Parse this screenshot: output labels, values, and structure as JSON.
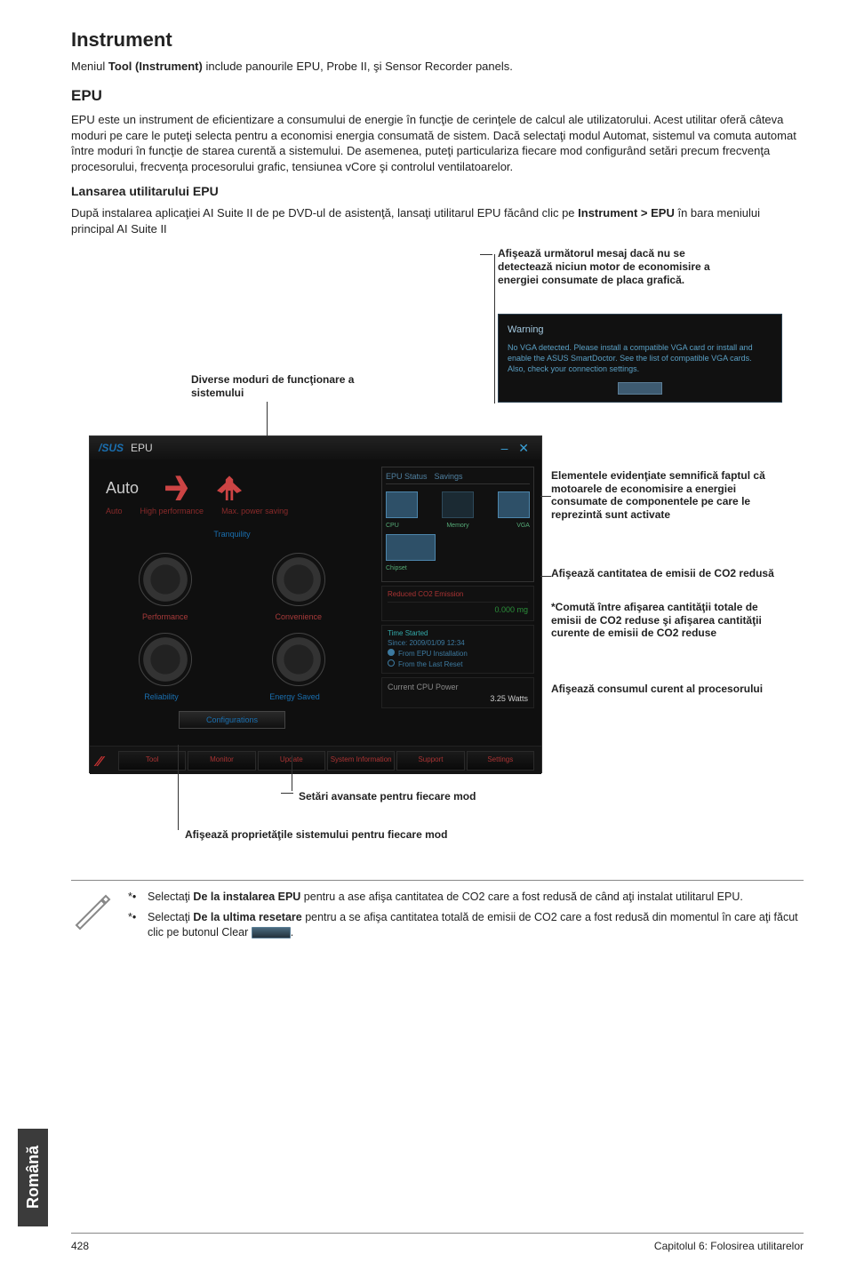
{
  "heading": "Instrument",
  "intro": {
    "pre": "Meniul ",
    "bold": "Tool (Instrument)",
    "post": " include panourile EPU, Probe II, şi  Sensor Recorder panels."
  },
  "epu_heading": "EPU",
  "epu_para": "EPU este un instrument de eficientizare a consumului de energie în funcţie de cerinţele de calcul ale utilizatorului. Acest utilitar oferă câteva moduri pe care le puteţi selecta pentru a economisi energia consumată de sistem. Dacă selectaţi modul Automat, sistemul va comuta automat între moduri în funcţie de starea curentă a sistemului. De asemenea, puteţi particulariza fiecare mod configurând setări precum frecvenţa procesorului, frecvenţa procesorului grafic, tensiunea vCore şi controlul ventilatoarelor.",
  "launch_heading": "Lansarea utilitarului EPU",
  "launch_para": {
    "p1": "După instalarea aplicaţiei AI Suite II de pe DVD-ul de asistenţă, lansaţi utilitarul EPU făcând clic pe ",
    "bold": "Instrument > EPU",
    "p2": " în bara meniului principal AI Suite II"
  },
  "callouts": {
    "warning": "Afişează următorul mesaj dacă nu se detectează niciun motor de economisire a energiei consumate de placa grafică.",
    "modes": "Diverse moduri de funcţionare a sistemului",
    "elements": "Elementele evidenţiate semnifică faptul că motoarele de economisire a energiei consumate de componentele pe care le reprezintă sunt activate",
    "co2": "Afişează cantitatea de emisii de CO2 redusă",
    "toggle": "*Comută între afişarea cantităţii totale de emisii de CO2 reduse şi afişarea cantităţii curente de emisii de CO2 reduse",
    "power": "Afişează consumul curent al procesorului",
    "settings": "Setări avansate pentru fiecare mod",
    "props": "Afişează proprietăţile sistemului pentru fiecare mod"
  },
  "app": {
    "brand": "/SUS",
    "title": "EPU",
    "auto": "Auto",
    "auto_sub1": "Auto",
    "auto_sub2": "High performance",
    "auto_sub3": "Max. power saving",
    "tranquility": "Tranquility",
    "performance": "Performance",
    "convenience": "Convenience",
    "reliability": "Reliability",
    "energy": "Energy Saved",
    "config": "Configurations",
    "status_head1": "EPU Status",
    "status_head2": "Savings",
    "thumb_cpu": "CPU",
    "thumb_mem": "Memory",
    "thumb_vga": "VGA",
    "chipset": "Chipset",
    "co2_head": "Reduced CO2 Emission",
    "co2_val": "0.000 mg",
    "since_head": "Time Started",
    "since_date": "Since: 2009/01/09 12:34",
    "radio_on": "From EPU Installation",
    "radio_off": "From the Last Reset",
    "power_head": "Current CPU Power",
    "power_val": "3.25 Watts",
    "footer": [
      "Tool",
      "Monitor",
      "Update",
      "System Information",
      "Support",
      "Settings"
    ]
  },
  "warn_box": {
    "title": "Warning",
    "body": "No VGA detected. Please install a compatible VGA card or install and enable the ASUS SmartDoctor. See the list of compatible VGA cards.",
    "body2": "Also, check your connection settings."
  },
  "notes": {
    "n1a": "Selectaţi ",
    "n1b": "De la instalarea EPU",
    "n1c": " pentru a ase afişa cantitatea de CO2 care a fost redusă de când aţi instalat utilitarul EPU.",
    "n2a": "Selectaţi ",
    "n2b": "De la ultima resetare",
    "n2c": " pentru a se afişa cantitatea totală de emisii de CO2 care a fost redusă din momentul în care aţi făcut clic pe butonul Clear ",
    "n2d": "."
  },
  "side_tab": "Română",
  "footer_left": "428",
  "footer_right": "Capitolul 6: Folosirea utilitarelor"
}
